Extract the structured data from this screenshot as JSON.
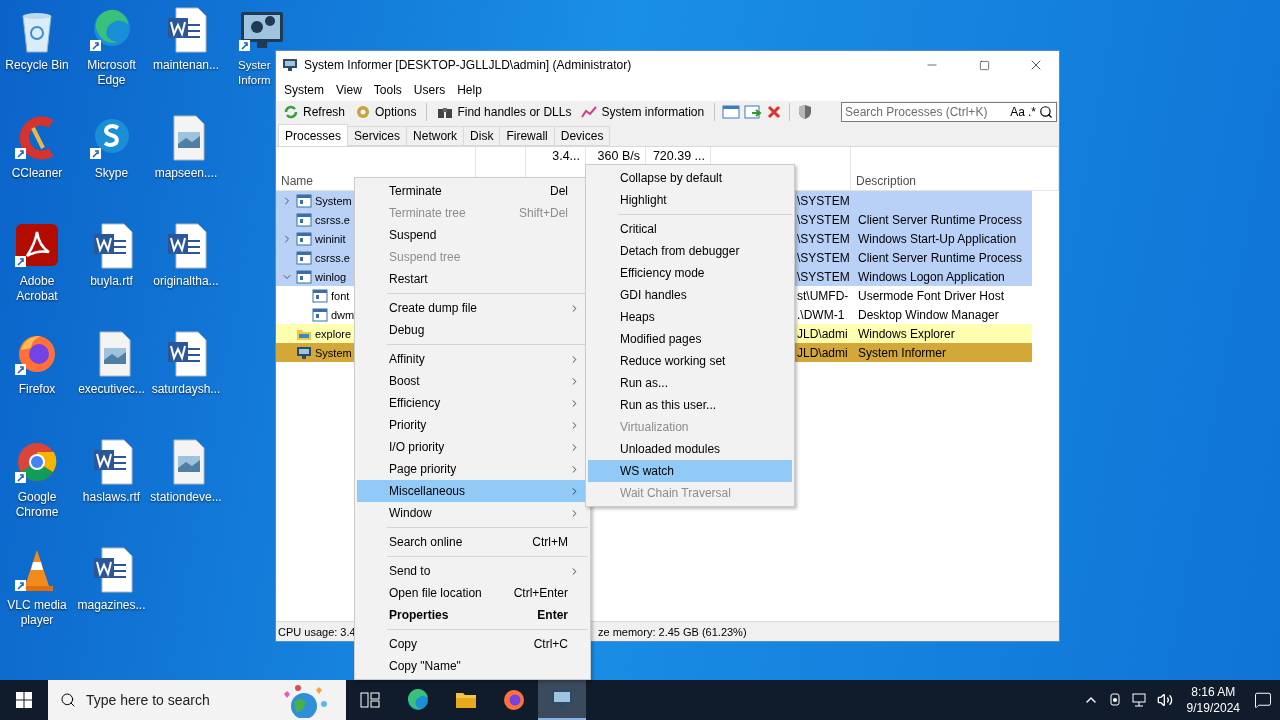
{
  "desktop_icons": [
    {
      "label": "Recycle Bin"
    },
    {
      "label": "Microsoft Edge"
    },
    {
      "label": "maintenan..."
    },
    {
      "label": "Syster Inform"
    },
    {
      "label": "CCleaner"
    },
    {
      "label": "Skype"
    },
    {
      "label": "mapseen...."
    },
    {
      "label": "Adobe Acrobat"
    },
    {
      "label": "buyla.rtf"
    },
    {
      "label": "originaltha..."
    },
    {
      "label": "Firefox"
    },
    {
      "label": "executivec..."
    },
    {
      "label": "saturdaysh..."
    },
    {
      "label": "Google Chrome"
    },
    {
      "label": "haslaws.rtf"
    },
    {
      "label": "stationdeve..."
    },
    {
      "label": "VLC media player"
    },
    {
      "label": "magazines..."
    }
  ],
  "window": {
    "title": "System Informer [DESKTOP-JGLLJLD\\admin] (Administrator)",
    "menu": [
      "System",
      "View",
      "Tools",
      "Users",
      "Help"
    ],
    "toolbar": {
      "buttons": [
        "Refresh",
        "Options",
        "Find handles or DLLs",
        "System information"
      ],
      "search_placeholder": "Search Processes (Ctrl+K)",
      "case_toggle": "Aa",
      "regex_toggle": ".*"
    },
    "tabs": [
      {
        "label": "Processes",
        "selected": true
      },
      {
        "label": "Services",
        "selected": false
      },
      {
        "label": "Network",
        "selected": false
      },
      {
        "label": "Disk",
        "selected": false
      },
      {
        "label": "Firewall",
        "selected": false
      },
      {
        "label": "Devices",
        "selected": false
      }
    ],
    "table": {
      "summary": [
        "3.4...",
        "360 B/s",
        "720.39 ..."
      ],
      "columns": [
        "Name",
        "Description"
      ],
      "rows": [
        {
          "name": "System",
          "user": "\\SYSTEM",
          "description": "",
          "color": "#b9d1f7",
          "expanded": false
        },
        {
          "name": "csrss.e",
          "user": "\\SYSTEM",
          "description": "Client Server Runtime Process",
          "color": "#b9d1f7"
        },
        {
          "name": "wininit",
          "user": "\\SYSTEM",
          "description": "Windows Start-Up Application",
          "color": "#b9d1f7",
          "expanded": false
        },
        {
          "name": "csrss.e",
          "user": "\\SYSTEM",
          "description": "Client Server Runtime Process",
          "color": "#b9d1f7"
        },
        {
          "name": "winlog",
          "user": "\\SYSTEM",
          "description": "Windows Logon Application",
          "color": "#b9d1f7",
          "expanded": true,
          "children": [
            {
              "name": "font",
              "user": "st\\UMFD-",
              "description": "Usermode Font Driver Host",
              "color": "#ffffff"
            },
            {
              "name": "dwm",
              "user": ".\\DWM-1",
              "description": "Desktop Window Manager",
              "color": "#ffffff"
            }
          ]
        },
        {
          "name": "explore",
          "user": "JLD\\admi",
          "description": "Windows Explorer",
          "color": "#ffffb0"
        },
        {
          "name": "System",
          "user": "JLD\\admi",
          "description": "System Informer",
          "color": "#d4a838"
        }
      ]
    },
    "status": [
      "CPU usage: 3.4",
      "ze memory: 2.45 GB (61.23%)"
    ]
  },
  "context_menu": [
    {
      "kind": "item",
      "label": "Terminate",
      "shortcut": "Del",
      "disabled": false,
      "selected": false
    },
    {
      "kind": "item",
      "label": "Terminate tree",
      "shortcut": "Shift+Del",
      "disabled": true,
      "selected": false
    },
    {
      "kind": "item",
      "label": "Suspend",
      "disabled": false,
      "selected": false
    },
    {
      "kind": "item",
      "label": "Suspend tree",
      "disabled": true,
      "selected": false
    },
    {
      "kind": "item",
      "label": "Restart",
      "disabled": false,
      "selected": false
    },
    {
      "kind": "separator"
    },
    {
      "kind": "item",
      "label": "Create dump file",
      "submenu": true,
      "disabled": false,
      "selected": false
    },
    {
      "kind": "item",
      "label": "Debug",
      "disabled": false,
      "selected": false
    },
    {
      "kind": "separator"
    },
    {
      "kind": "item",
      "label": "Affinity",
      "submenu": true,
      "disabled": false,
      "selected": false
    },
    {
      "kind": "item",
      "label": "Boost",
      "submenu": true,
      "disabled": false,
      "selected": false
    },
    {
      "kind": "item",
      "label": "Efficiency",
      "submenu": true,
      "disabled": false,
      "selected": false
    },
    {
      "kind": "item",
      "label": "Priority",
      "submenu": true,
      "disabled": false,
      "selected": false
    },
    {
      "kind": "item",
      "label": "I/O priority",
      "submenu": true,
      "disabled": false,
      "selected": false
    },
    {
      "kind": "item",
      "label": "Page priority",
      "submenu": true,
      "disabled": false,
      "selected": false
    },
    {
      "kind": "item",
      "label": "Miscellaneous",
      "submenu": true,
      "disabled": false,
      "selected": true
    },
    {
      "kind": "item",
      "label": "Window",
      "submenu": true,
      "disabled": false,
      "selected": false
    },
    {
      "kind": "separator"
    },
    {
      "kind": "item",
      "label": "Search online",
      "shortcut": "Ctrl+M",
      "disabled": false,
      "selected": false
    },
    {
      "kind": "separator"
    },
    {
      "kind": "item",
      "label": "Send to",
      "submenu": true,
      "disabled": false,
      "selected": false
    },
    {
      "kind": "item",
      "label": "Open file location",
      "shortcut": "Ctrl+Enter",
      "disabled": false,
      "selected": false
    },
    {
      "kind": "item",
      "label": "Properties",
      "shortcut": "Enter",
      "default": true,
      "disabled": false,
      "selected": false
    },
    {
      "kind": "separator"
    },
    {
      "kind": "item",
      "label": "Copy",
      "shortcut": "Ctrl+C",
      "disabled": false,
      "selected": false
    },
    {
      "kind": "item",
      "label": "Copy \"Name\"",
      "disabled": false,
      "selected": false
    }
  ],
  "submenu": [
    {
      "kind": "item",
      "label": "Collapse by default",
      "disabled": false,
      "selected": false
    },
    {
      "kind": "item",
      "label": "Highlight",
      "disabled": false,
      "selected": false
    },
    {
      "kind": "separator"
    },
    {
      "kind": "item",
      "label": "Critical",
      "disabled": false,
      "selected": false
    },
    {
      "kind": "item",
      "label": "Detach from debugger",
      "disabled": false,
      "selected": false
    },
    {
      "kind": "item",
      "label": "Efficiency mode",
      "disabled": false,
      "selected": false
    },
    {
      "kind": "item",
      "label": "GDI handles",
      "disabled": false,
      "selected": false
    },
    {
      "kind": "item",
      "label": "Heaps",
      "disabled": false,
      "selected": false
    },
    {
      "kind": "item",
      "label": "Modified pages",
      "disabled": false,
      "selected": false
    },
    {
      "kind": "item",
      "label": "Reduce working set",
      "disabled": false,
      "selected": false
    },
    {
      "kind": "item",
      "label": "Run as...",
      "disabled": false,
      "selected": false
    },
    {
      "kind": "item",
      "label": "Run as this user...",
      "disabled": false,
      "selected": false
    },
    {
      "kind": "item",
      "label": "Virtualization",
      "disabled": true,
      "selected": false
    },
    {
      "kind": "item",
      "label": "Unloaded modules",
      "disabled": false,
      "selected": false
    },
    {
      "kind": "item",
      "label": "WS watch",
      "disabled": false,
      "selected": true
    },
    {
      "kind": "item",
      "label": "Wait Chain Traversal",
      "disabled": true,
      "selected": false
    }
  ],
  "taskbar": {
    "search_placeholder": "Type here to search",
    "apps": [
      {
        "selected": false
      },
      {
        "selected": false
      },
      {
        "selected": false
      },
      {
        "selected": false
      },
      {
        "selected": true
      }
    ],
    "time": "8:16 AM",
    "date": "9/19/2024"
  }
}
